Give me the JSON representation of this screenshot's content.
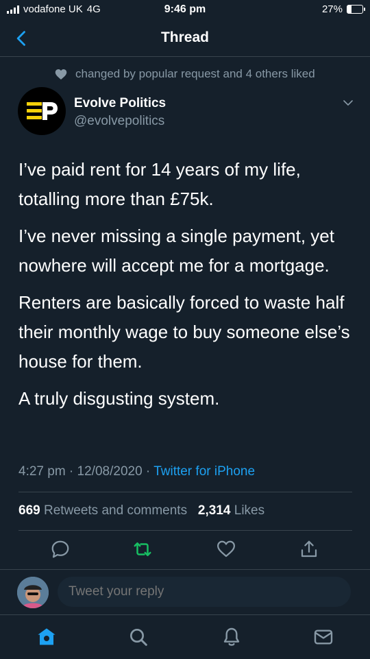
{
  "status_bar": {
    "carrier": "vodafone UK",
    "network": "4G",
    "time": "9:46 pm",
    "battery": "27%",
    "battery_level": 0.27
  },
  "nav": {
    "title": "Thread",
    "back_icon": "chevron-left-icon"
  },
  "tweet": {
    "liked_text": "changed by popular request and 4 others liked",
    "display_name": "Evolve Politics",
    "handle": "@evolvepolitics",
    "paragraphs": [
      "I’ve paid rent for 14 years of my life, totalling more than £75k.",
      "I’ve never missing a single payment, yet nowhere will accept me for a mortgage.",
      "Renters are basically forced to waste half their monthly wage to buy someone else’s house for them.",
      "A truly disgusting system."
    ],
    "time": "4:27 pm",
    "date": "12/08/2020",
    "source": "Twitter for iPhone",
    "retweets_count": "669",
    "retweets_label": "Retweets and comments",
    "likes_count": "2,314",
    "likes_label": "Likes"
  },
  "reply": {
    "placeholder": "Tweet your reply"
  },
  "colors": {
    "background": "#15202b",
    "muted": "#8899a6",
    "accent": "#1da1f2",
    "retweet": "#17bf63",
    "divider": "#38444d"
  }
}
